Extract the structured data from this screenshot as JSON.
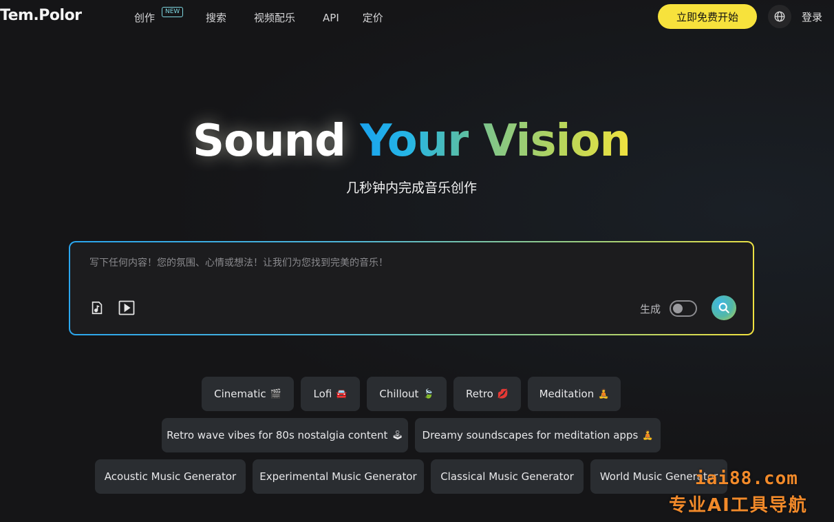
{
  "header": {
    "logo": "Tem.Polor",
    "nav": {
      "create": "创作",
      "new_badge": "NEW",
      "search": "搜索",
      "video_music": "视频配乐",
      "api": "API",
      "pricing": "定价"
    },
    "cta": "立即免费开始",
    "login": "登录"
  },
  "hero": {
    "title_word1": "Sound",
    "title_word2": "Your",
    "title_word3": "Vision",
    "subtitle": "几秒钟内完成音乐创作"
  },
  "prompt": {
    "placeholder": "写下任何内容！您的氛围、心情或想法！让我们为您找到完美的音乐！",
    "value": "",
    "generate_label": "生成",
    "generate_toggle_on": false
  },
  "chips": {
    "row1": [
      {
        "label": "Cinematic",
        "emoji": "🎬"
      },
      {
        "label": "Lofi",
        "emoji": "🚘"
      },
      {
        "label": "Chillout",
        "emoji": "🍃"
      },
      {
        "label": "Retro",
        "emoji": "💋"
      },
      {
        "label": "Meditation",
        "emoji": "🧘"
      }
    ],
    "row2": [
      {
        "label": "Retro wave vibes for 80s nostalgia content",
        "emoji": "🕹"
      },
      {
        "label": "Dreamy soundscapes for meditation apps",
        "emoji": "🧘"
      }
    ],
    "row3": [
      {
        "label": "Acoustic Music Generator"
      },
      {
        "label": "Experimental Music Generator"
      },
      {
        "label": "Classical Music Generator"
      },
      {
        "label": "World Music Generator"
      }
    ]
  },
  "watermark": {
    "line1": "iai88.com",
    "line2": "专业AI工具导航"
  },
  "colors": {
    "cta": "#f7e23c",
    "accent_blue": "#1aa3ee",
    "accent_green": "#7cc48d",
    "accent_yellow": "#f1e23f",
    "watermark": "#f28a2a"
  },
  "icons": [
    "globe-icon",
    "music-note-icon",
    "play-icon",
    "search-icon"
  ]
}
